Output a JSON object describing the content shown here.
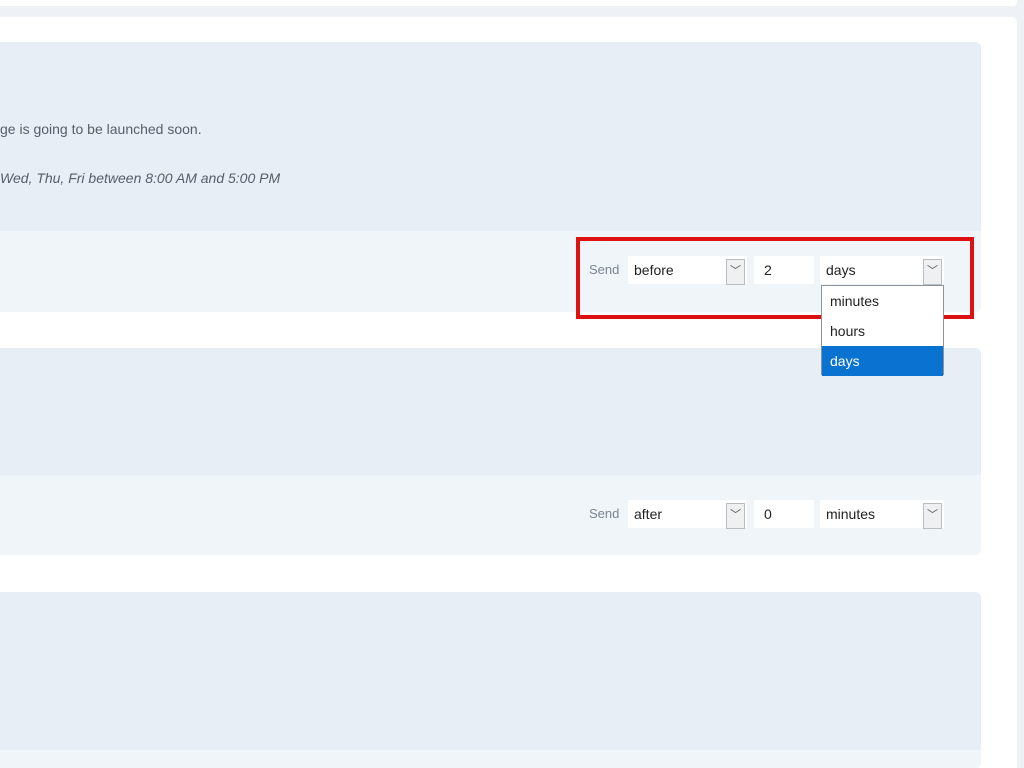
{
  "reminders": [
    {
      "description": "ge is going to be launched soon.",
      "schedule": "Wed, Thu, Fri between 8:00 AM and 5:00 PM",
      "send_label": "Send",
      "timing": "before",
      "amount": "2",
      "unit": "days",
      "unit_dropdown": {
        "open": true,
        "options": [
          "minutes",
          "hours",
          "days"
        ],
        "selected": "days"
      }
    },
    {
      "send_label": "Send",
      "timing": "after",
      "amount": "0",
      "unit": "minutes"
    }
  ],
  "colors": {
    "highlight": "#dd1111",
    "selected_option": "#0a73d1",
    "card_bg": "#e8eef5",
    "card_footer_bg": "#f0f5f9"
  },
  "icons": {
    "select_arrow": "chevron-down-icon"
  }
}
